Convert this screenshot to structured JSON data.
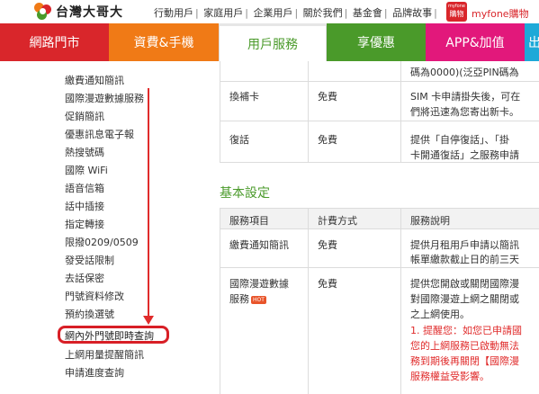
{
  "header": {
    "brand": "台灣大哥大",
    "links": [
      "行動用戶",
      "家庭用戶",
      "企業用戶",
      "關於我們",
      "基金會",
      "品牌故事"
    ],
    "myfone_badge_top": "myfone",
    "myfone_badge_bottom": "購物",
    "myfone_link": "myfone購物"
  },
  "nav": {
    "tabs": [
      {
        "label": "網路門市",
        "color": "#d9262b"
      },
      {
        "label": "資費&手機",
        "color": "#f07a16"
      },
      {
        "label": "用戶服務",
        "color": "#ffffff"
      },
      {
        "label": "享優惠",
        "color": "#4a9a2a"
      },
      {
        "label": "APP&加值",
        "color": "#e2187b"
      },
      {
        "label": "出國",
        "color": "#1ea9d8"
      }
    ]
  },
  "sidebar": {
    "items": [
      "繳費通知簡訊",
      "國際漫遊數據服務",
      "促銷簡訊",
      "優惠訊息電子報",
      "熱搜號碼",
      "國際 WiFi",
      "語音信箱",
      "話中插接",
      "指定轉接",
      "限撥0209/0509",
      "發受話限制",
      "去話保密",
      "門號資料修改",
      "預約換選號",
      "網內外門號即時查詢",
      "上網用量提醒簡訊",
      "申請進度查詢"
    ]
  },
  "main": {
    "top_rows": [
      {
        "item": "",
        "fee": "",
        "desc1": "碼為0000)(泛亞PIN碼為",
        "desc2": ""
      },
      {
        "item": "換補卡",
        "fee": "免費",
        "desc1": "SIM 卡申請掛失後，可在",
        "desc2": "們將迅速為您寄出新卡。"
      },
      {
        "item": "復話",
        "fee": "免費",
        "desc1": "提供「自停復話」、「掛",
        "desc2": "卡開通復話」之服務申請"
      }
    ],
    "section_title": "基本設定",
    "headers": [
      "服務項目",
      "計費方式",
      "服務說明"
    ],
    "rows": [
      {
        "item": "繳費通知簡訊",
        "fee": "免費",
        "desc1": "提供月租用戶申請以簡訊",
        "desc2": "帳單繳款截止日的前三天"
      },
      {
        "item1": "國際漫遊數據",
        "item2": "服務",
        "hot": "HOT",
        "fee": "免費",
        "desc1": "提供您開啟或關閉國際漫",
        "desc2": "對國際漫遊上網之關閉或",
        "desc3": "之上網使用。",
        "warn1": "1. 提醒您：如您已申請國",
        "warn2": "您的上網服務已啟動無法",
        "warn3": "務到期後再關閉【國際漫",
        "warn4": "服務權益受影響。"
      }
    ]
  }
}
